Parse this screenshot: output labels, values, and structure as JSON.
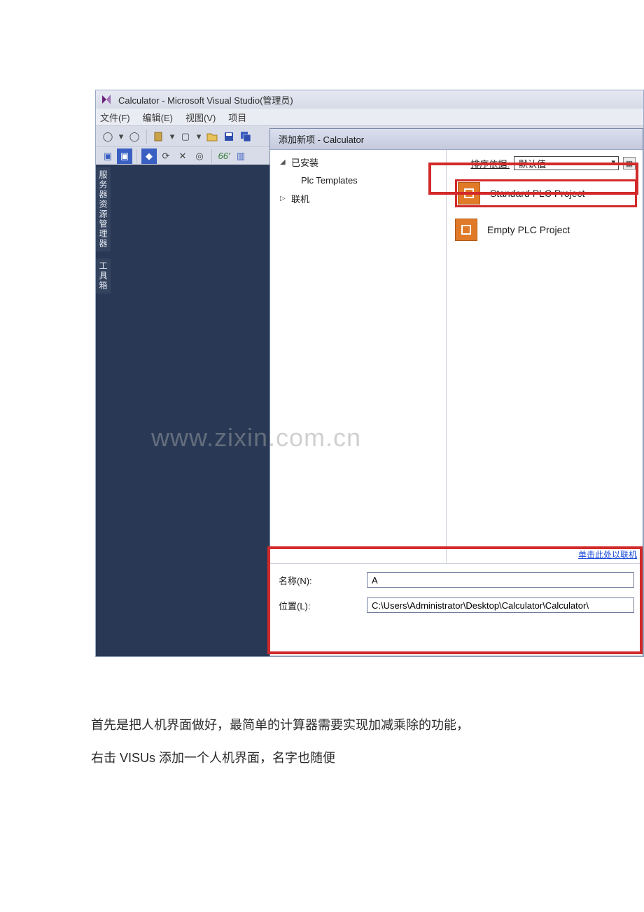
{
  "vs": {
    "window_title": "Calculator - Microsoft Visual Studio(管理员)",
    "menus": [
      "文件(F)",
      "编辑(E)",
      "视图(V)",
      "项目"
    ]
  },
  "side_tabs": [
    "服务器资源管理器",
    "工具箱"
  ],
  "dialog": {
    "title": "添加新项 - Calculator",
    "tree": {
      "installed": "已安装",
      "plc_templates": "Plc Templates",
      "online": "联机"
    },
    "sort_label": "排序依据:",
    "sort_value": "默认值",
    "templates": [
      {
        "name": "Standard PLC Project"
      },
      {
        "name": "Empty PLC Project"
      }
    ],
    "online_link": "单击此处以联机",
    "name_label": "名称(N):",
    "name_value": "A",
    "loc_label": "位置(L):",
    "loc_value": "C:\\Users\\Administrator\\Desktop\\Calculator\\Calculator\\"
  },
  "watermark": "www.zixin.com.cn",
  "paragraphs": [
    "首先是把人机界面做好，最简单的计算器需要实现加减乘除的功能，",
    "右击 VISUs 添加一个人机界面，名字也随便"
  ]
}
